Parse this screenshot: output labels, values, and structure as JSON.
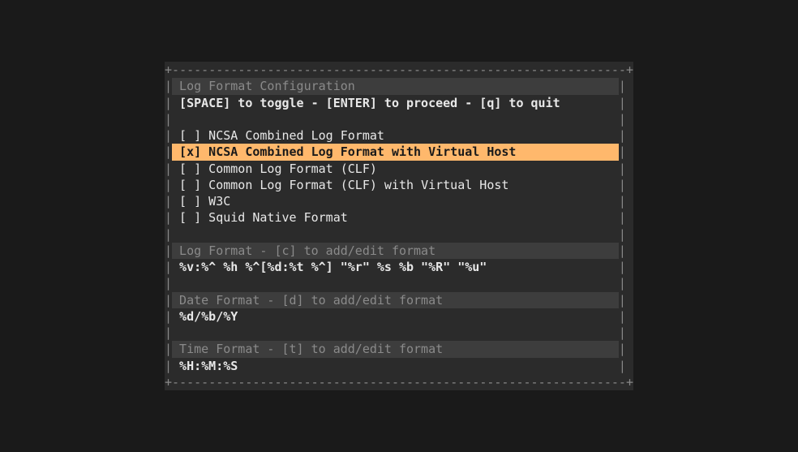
{
  "border": "+--------------------------------------------------------------+",
  "headers": {
    "config": "Log Format Configuration",
    "logformat": "Log Format - [c] to add/edit format",
    "dateformat": "Date Format - [d] to add/edit format",
    "timeformat": "Time Format - [t] to add/edit format"
  },
  "instruction": "[SPACE] to toggle - [ENTER] to proceed - [q] to quit",
  "options": [
    {
      "mark": "[ ]",
      "label": "NCSA Combined Log Format",
      "selected": false
    },
    {
      "mark": "[x]",
      "label": "NCSA Combined Log Format with Virtual Host",
      "selected": true
    },
    {
      "mark": "[ ]",
      "label": "Common Log Format (CLF)",
      "selected": false
    },
    {
      "mark": "[ ]",
      "label": "Common Log Format (CLF) with Virtual Host",
      "selected": false
    },
    {
      "mark": "[ ]",
      "label": "W3C",
      "selected": false
    },
    {
      "mark": "[ ]",
      "label": "Squid Native Format",
      "selected": false
    }
  ],
  "values": {
    "logformat": "%v:%^ %h %^[%d:%t %^] \"%r\" %s %b \"%R\" \"%u\"",
    "dateformat": "%d/%b/%Y",
    "timeformat": "%H:%M:%S"
  }
}
